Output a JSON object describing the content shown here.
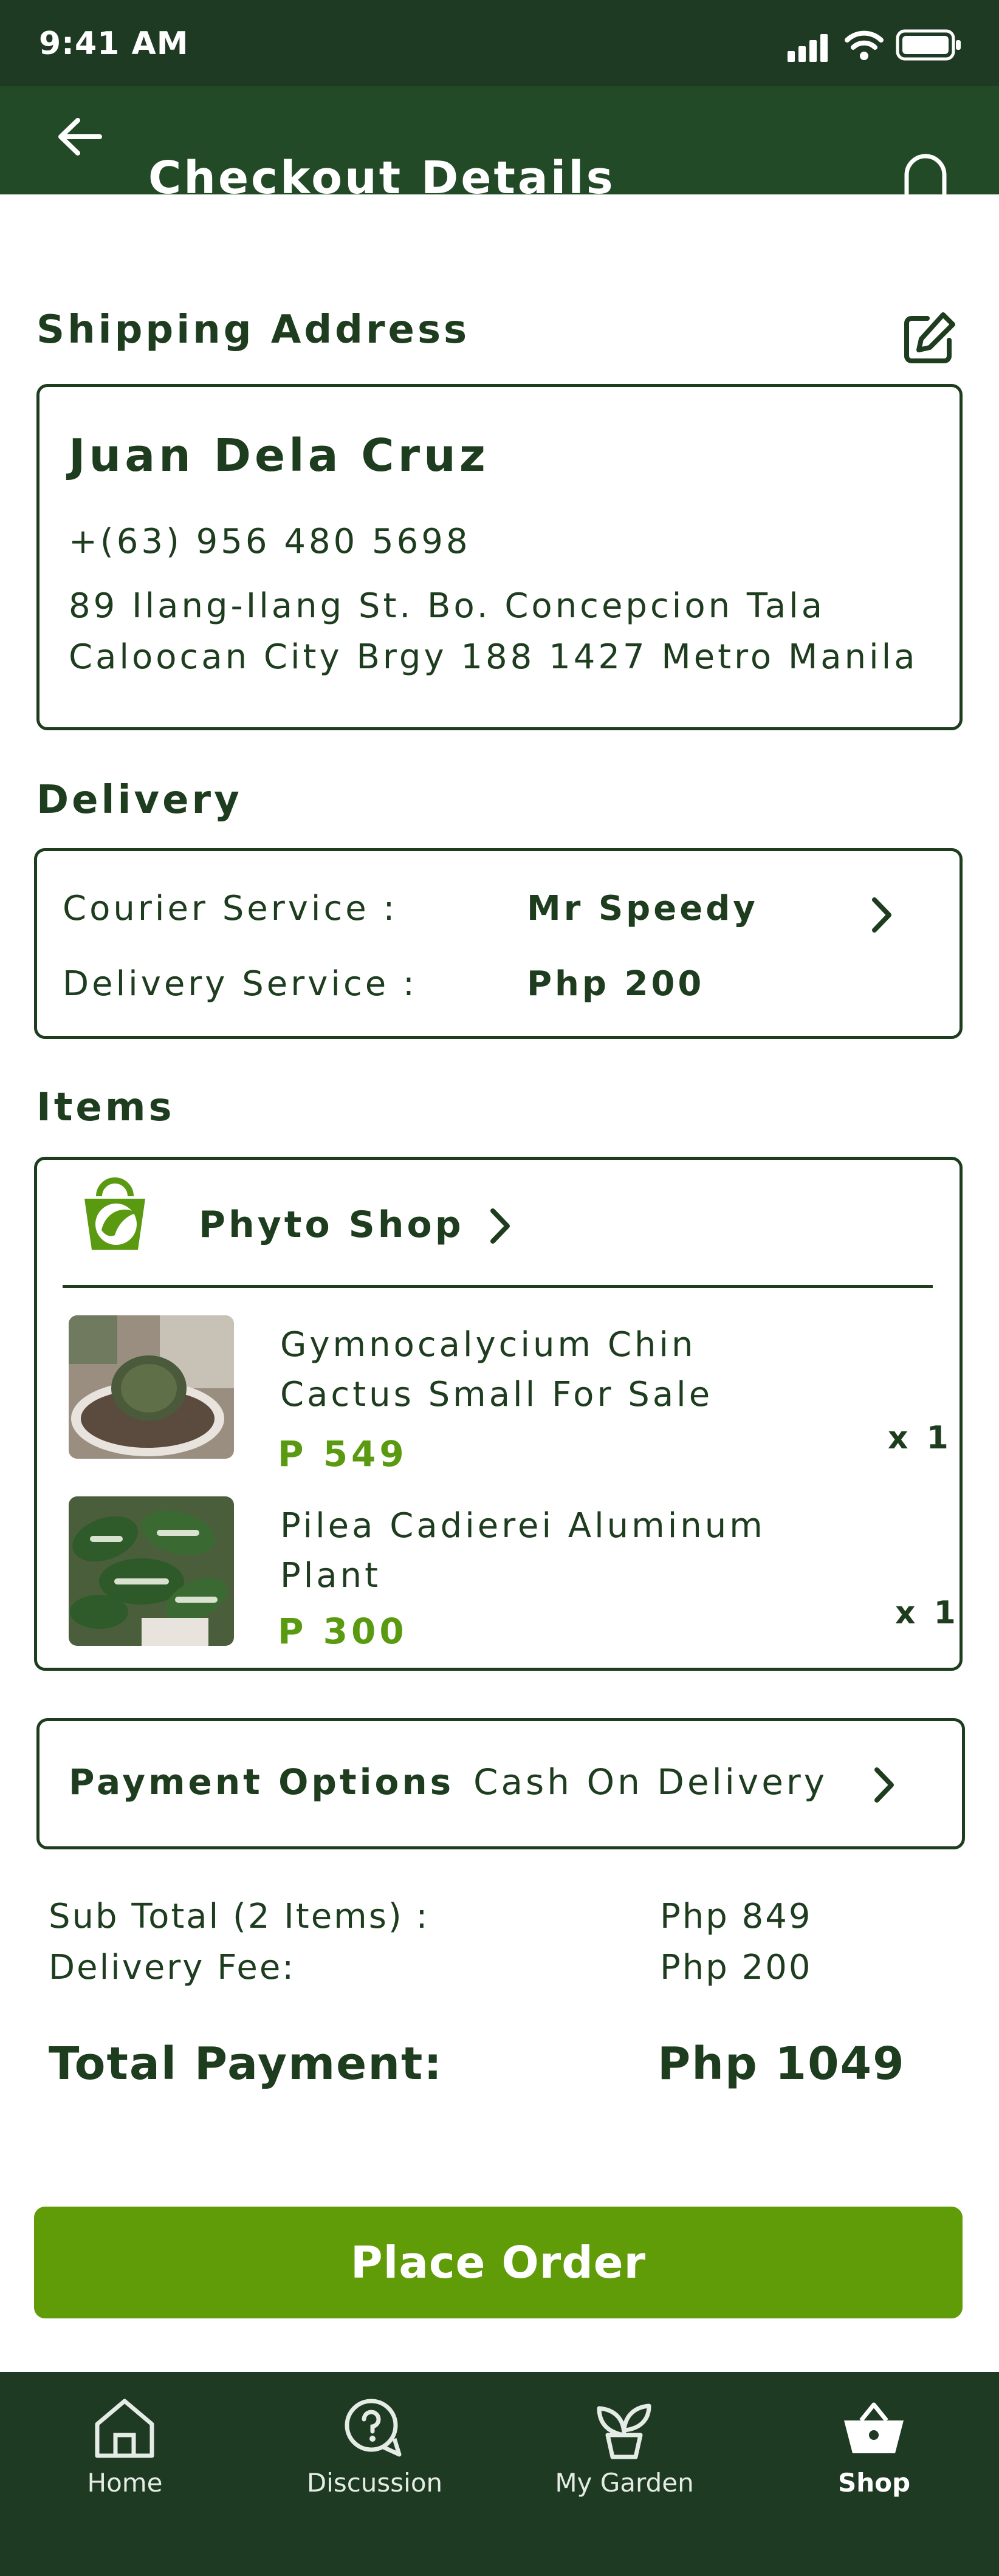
{
  "status_bar": {
    "time": "9:41 AM"
  },
  "header": {
    "title": "Checkout Details"
  },
  "shipping": {
    "heading": "Shipping Address",
    "name": "Juan Dela Cruz",
    "phone": "+(63) 956 480 5698",
    "address_line1": "89 Ilang-Ilang St. Bo. Concepcion Tala",
    "address_line2": "Caloocan City Brgy 188 1427 Metro Manila"
  },
  "delivery": {
    "heading": "Delivery",
    "courier_label": "Courier Service :",
    "courier_value": "Mr Speedy",
    "service_label": "Delivery Service :",
    "service_value": "Php 200"
  },
  "items": {
    "heading": "Items",
    "shop_name": "Phyto Shop",
    "list": [
      {
        "name_line1": "Gymnocalycium Chin",
        "name_line2": "Cactus Small For Sale",
        "price": "P 549",
        "qty": "x 1"
      },
      {
        "name_line1": "Pilea Cadierei Aluminum",
        "name_line2": "Plant",
        "price": "P 300",
        "qty": "x 1"
      }
    ]
  },
  "payment": {
    "label": "Payment Options",
    "value": "Cash On Delivery"
  },
  "summary": {
    "subtotal_label": "Sub Total (2 Items) :",
    "subtotal_value": "Php 849",
    "fee_label": "Delivery Fee:",
    "fee_value": "Php 200",
    "total_label": "Total Payment:",
    "total_value": "Php 1049"
  },
  "place_order": {
    "label": "Place Order"
  },
  "nav": {
    "items": [
      {
        "label": "Home",
        "icon": "home-icon",
        "active": false
      },
      {
        "label": "Discussion",
        "icon": "discussion-icon",
        "active": false
      },
      {
        "label": "My Garden",
        "icon": "plant-icon",
        "active": false
      },
      {
        "label": "Shop",
        "icon": "basket-icon",
        "active": true
      }
    ]
  },
  "colors": {
    "dark_green": "#1e3a22",
    "accent_green": "#5f9c07",
    "price_green": "#5a9a10"
  }
}
